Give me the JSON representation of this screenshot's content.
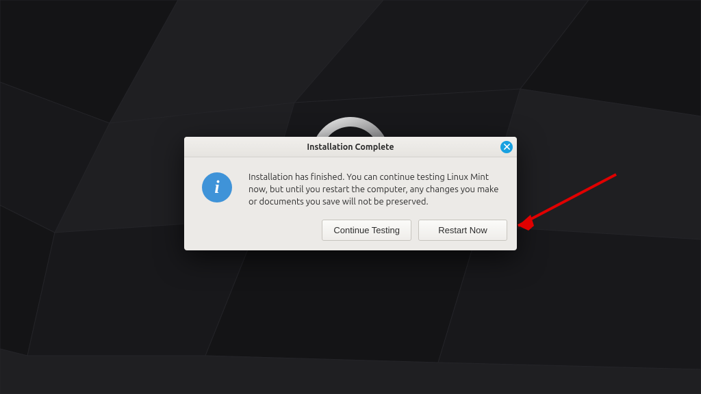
{
  "dialog": {
    "title": "Installation Complete",
    "icon_name": "info-icon",
    "message": "Installation has finished.  You can continue testing Linux Mint now, but until you restart the computer, any changes you make or documents you save will not be preserved.",
    "buttons": {
      "continue": "Continue Testing",
      "restart": "Restart Now"
    }
  },
  "colors": {
    "accent": "#18a0e0",
    "info_icon": "#3f93d8",
    "arrow": "#e00000"
  }
}
